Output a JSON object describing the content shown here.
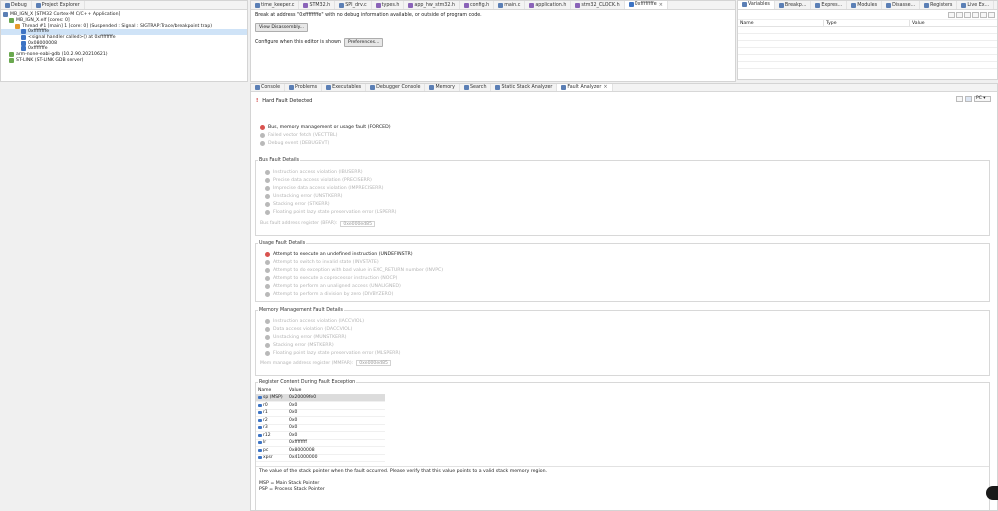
{
  "debug_panel": {
    "tabs": [
      {
        "label": "Debug"
      },
      {
        "label": "Project Explorer"
      }
    ],
    "tree": [
      {
        "label": "MB_IGN_X [STM32 Cortex-M C/C++ Application]",
        "indent": 0,
        "icon": "launch-icon"
      },
      {
        "label": "MB_IGN_X.elf [cores: 0]",
        "indent": 1,
        "icon": "elf-icon"
      },
      {
        "label": "Thread #1 [main] 1 [core: 0] (Suspended : Signal : SIGTRAP:Trace/breakpoint trap)",
        "indent": 2,
        "icon": "thread-icon"
      },
      {
        "label": "0xffffffffe",
        "indent": 3,
        "icon": "frame-icon",
        "selected": true
      },
      {
        "label": "<signal handler called>() at 0xffffffffe",
        "indent": 3,
        "icon": "frame-icon"
      },
      {
        "label": "0x08000008",
        "indent": 3,
        "icon": "frame-icon"
      },
      {
        "label": "0xfffffffe",
        "indent": 3,
        "icon": "frame-icon"
      },
      {
        "label": "arm-none-eabi-gdb (10.2.90.20210621)",
        "indent": 1,
        "icon": "gdb-icon"
      },
      {
        "label": "ST-LINK (ST-LINK GDB server)",
        "indent": 1,
        "icon": "server-icon"
      }
    ]
  },
  "editor": {
    "tabs": [
      {
        "label": "time_keeper.c",
        "type": "c"
      },
      {
        "label": "STM32.h",
        "type": "h"
      },
      {
        "label": "SPI_drv.c",
        "type": "c"
      },
      {
        "label": "types.h",
        "type": "h"
      },
      {
        "label": "app_hw_stm32.h",
        "type": "h"
      },
      {
        "label": "config.h",
        "type": "h"
      },
      {
        "label": "main.c",
        "type": "c"
      },
      {
        "label": "application.h",
        "type": "h"
      },
      {
        "label": "stm32_CLOCK.h",
        "type": "h"
      },
      {
        "label": "0xffffffffe",
        "type": "d",
        "active": true
      }
    ],
    "break_message": "Break at address \"0xffffffffe\" with no debug information available, or outside of program code.",
    "view_disassembly": "View Disassembly...",
    "configure_label": "Configure when this editor is shown",
    "preferences": "Preferences..."
  },
  "variables_panel": {
    "tabs": [
      {
        "label": "Variables",
        "active": true
      },
      {
        "label": "Breakp..."
      },
      {
        "label": "Expres..."
      },
      {
        "label": "Modules"
      },
      {
        "label": "Disasse..."
      },
      {
        "label": "Registers"
      },
      {
        "label": "Live Ex..."
      },
      {
        "label": "SFRs"
      }
    ],
    "columns": [
      "Name",
      "Type",
      "Value"
    ]
  },
  "bottom_tabs": [
    {
      "label": "Console"
    },
    {
      "label": "Problems"
    },
    {
      "label": "Executables"
    },
    {
      "label": "Debugger Console"
    },
    {
      "label": "Memory"
    },
    {
      "label": "Search"
    },
    {
      "label": "Static Stack Analyzer"
    },
    {
      "label": "Fault Analyzer",
      "active": true
    }
  ],
  "fault": {
    "header": "Hard Fault Detected",
    "pc_label": "PC",
    "hard_fault_items": [
      {
        "label": "Bus, memory management or usage fault (FORCED)",
        "active": true
      },
      {
        "label": "Failed vector fetch (VECTTBL)",
        "active": false
      },
      {
        "label": "Debug event (DEBUGEVT)",
        "active": false
      }
    ],
    "bus": {
      "title": "Bus Fault Details",
      "items": [
        {
          "label": "Instruction access violation (IBUSERR)",
          "active": false
        },
        {
          "label": "Precise data access violation (PRECISERR)",
          "active": false
        },
        {
          "label": "Imprecise data access violation (IMPRECISERR)",
          "active": false
        },
        {
          "label": "Unstacking error (UNSTKERR)",
          "active": false
        },
        {
          "label": "Stacking error (STKERR)",
          "active": false
        },
        {
          "label": "Floating point lazy state preservation error (LSPERR)",
          "active": false
        }
      ],
      "address_label": "Bus fault address register (BFAR):",
      "address_value": "0xe000ed85"
    },
    "usage": {
      "title": "Usage Fault Details",
      "items": [
        {
          "label": "Attempt to execute an undefined instruction (UNDEFINSTR)",
          "active": true
        },
        {
          "label": "Attempt to switch to invalid state (INVSTATE)",
          "active": false
        },
        {
          "label": "Attempt to do exception with bad value in EXC_RETURN number (INVPC)",
          "active": false
        },
        {
          "label": "Attempt to execute a coprocessor instruction (NOCP)",
          "active": false
        },
        {
          "label": "Attempt to perform an unaligned access (UNALIGNED)",
          "active": false
        },
        {
          "label": "Attempt to perform a division by zero (DIVBYZERO)",
          "active": false
        }
      ]
    },
    "memory": {
      "title": "Memory Management Fault Details",
      "items": [
        {
          "label": "Instruction access violation (IACCVIOL)",
          "active": false
        },
        {
          "label": "Data access violation (DACCVIOL)",
          "active": false
        },
        {
          "label": "Unstacking error (MUNSTKERR)",
          "active": false
        },
        {
          "label": "Stacking error (MSTKERR)",
          "active": false
        },
        {
          "label": "Floating point lazy state preservation error (MLSPERR)",
          "active": false
        }
      ],
      "address_label": "Mem manage address register (MMFAR):",
      "address_value": "0xe000ed85"
    },
    "registers": {
      "title": "Register Content During Fault Exception",
      "columns": [
        "Name",
        "Value"
      ],
      "rows": [
        {
          "name": "sp (MSP)",
          "value": "0x20009fe0",
          "selected": true
        },
        {
          "name": "r0",
          "value": "0x0"
        },
        {
          "name": "r1",
          "value": "0x0"
        },
        {
          "name": "r2",
          "value": "0x0"
        },
        {
          "name": "r3",
          "value": "0x0"
        },
        {
          "name": "r12",
          "value": "0x0"
        },
        {
          "name": "lr",
          "value": "0xffffffff"
        },
        {
          "name": "pc",
          "value": "0x8000008"
        },
        {
          "name": "xpsr",
          "value": "0x41000000"
        }
      ]
    },
    "note_lines": [
      "The value of the stack pointer when the fault occurred. Please verify that this value points to a valid stack memory region.",
      "",
      "MSP = Main Stack Pointer",
      "PSP = Process Stack Pointer"
    ]
  }
}
